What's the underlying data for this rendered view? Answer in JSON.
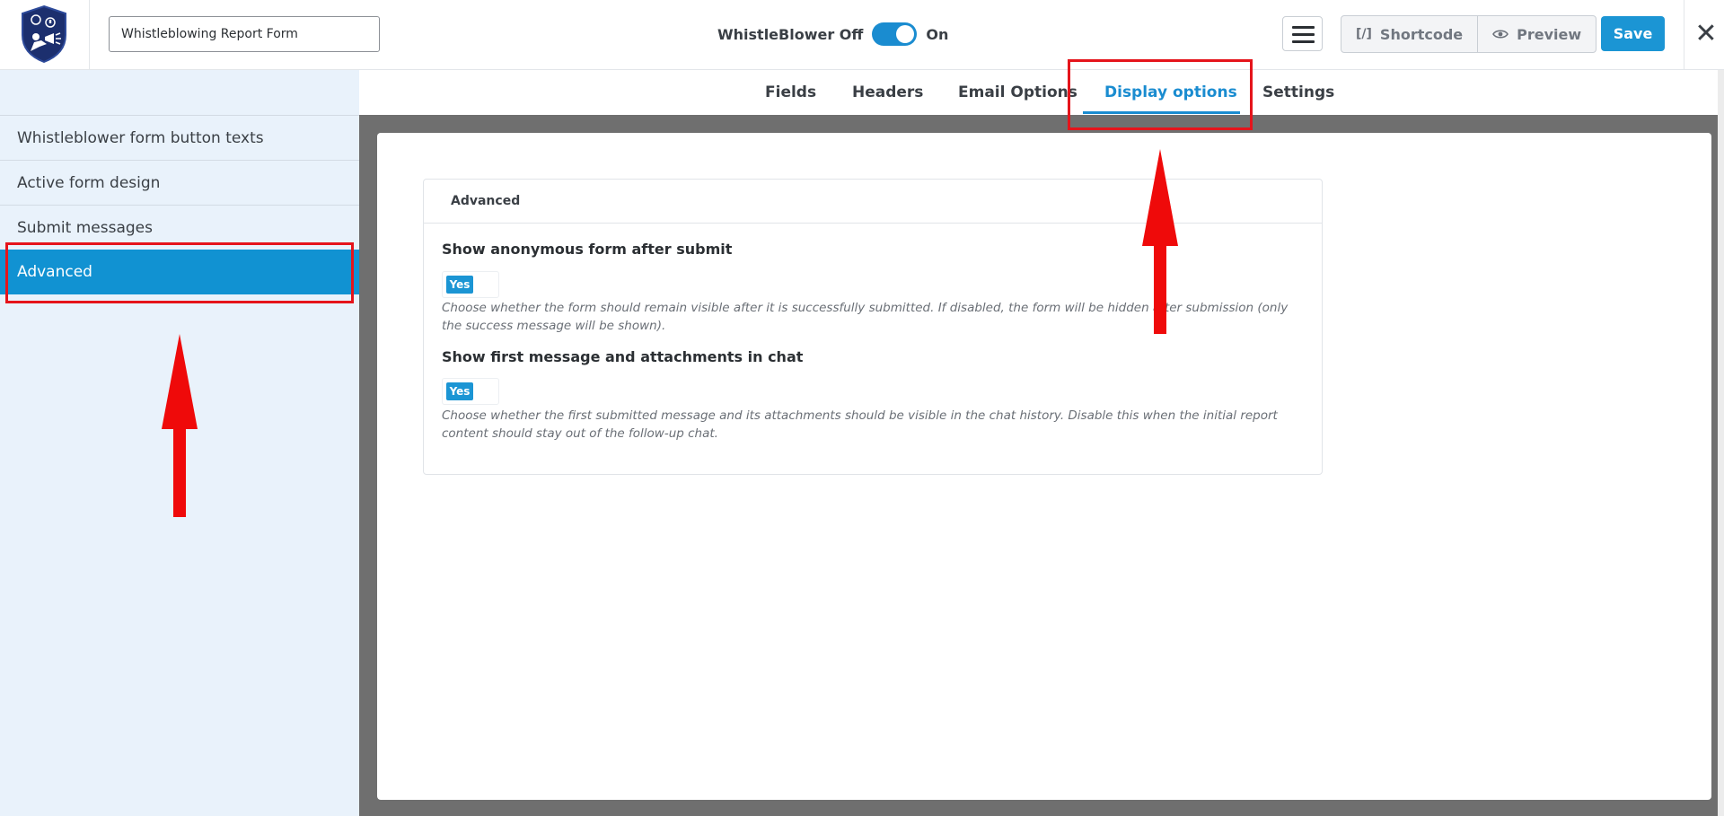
{
  "header": {
    "form_title_value": "Whistleblowing Report Form",
    "toggle_off_label": "WhistleBlower Off",
    "toggle_on_label": "On",
    "toggle_state": "on",
    "shortcode_label": "Shortcode",
    "preview_label": "Preview",
    "save_label": "Save",
    "brand_color": "#1a8cd0"
  },
  "sidebar": {
    "items": [
      {
        "label": "Whistleblower form button texts"
      },
      {
        "label": "Active form design"
      },
      {
        "label": "Submit messages"
      },
      {
        "label": "Advanced",
        "active": true
      }
    ]
  },
  "tabs": [
    {
      "label": "Fields"
    },
    {
      "label": "Headers"
    },
    {
      "label": "Email Options"
    },
    {
      "label": "Display options",
      "active": true
    },
    {
      "label": "Settings"
    }
  ],
  "main": {
    "card_title": "Advanced",
    "options": [
      {
        "title": "Show anonymous form after submit",
        "value": "Yes",
        "description": "Choose whether the form should remain visible after it is successfully submitted. If disabled, the form will be hidden after submission (only the success message will be shown)."
      },
      {
        "title": "Show first message and attachments in chat",
        "value": "Yes",
        "description": "Choose whether the first submitted message and its attachments should be visible in the chat history. Disable this when the initial report content should stay out of the follow-up chat."
      }
    ]
  },
  "annotation_color": "#e5141b"
}
